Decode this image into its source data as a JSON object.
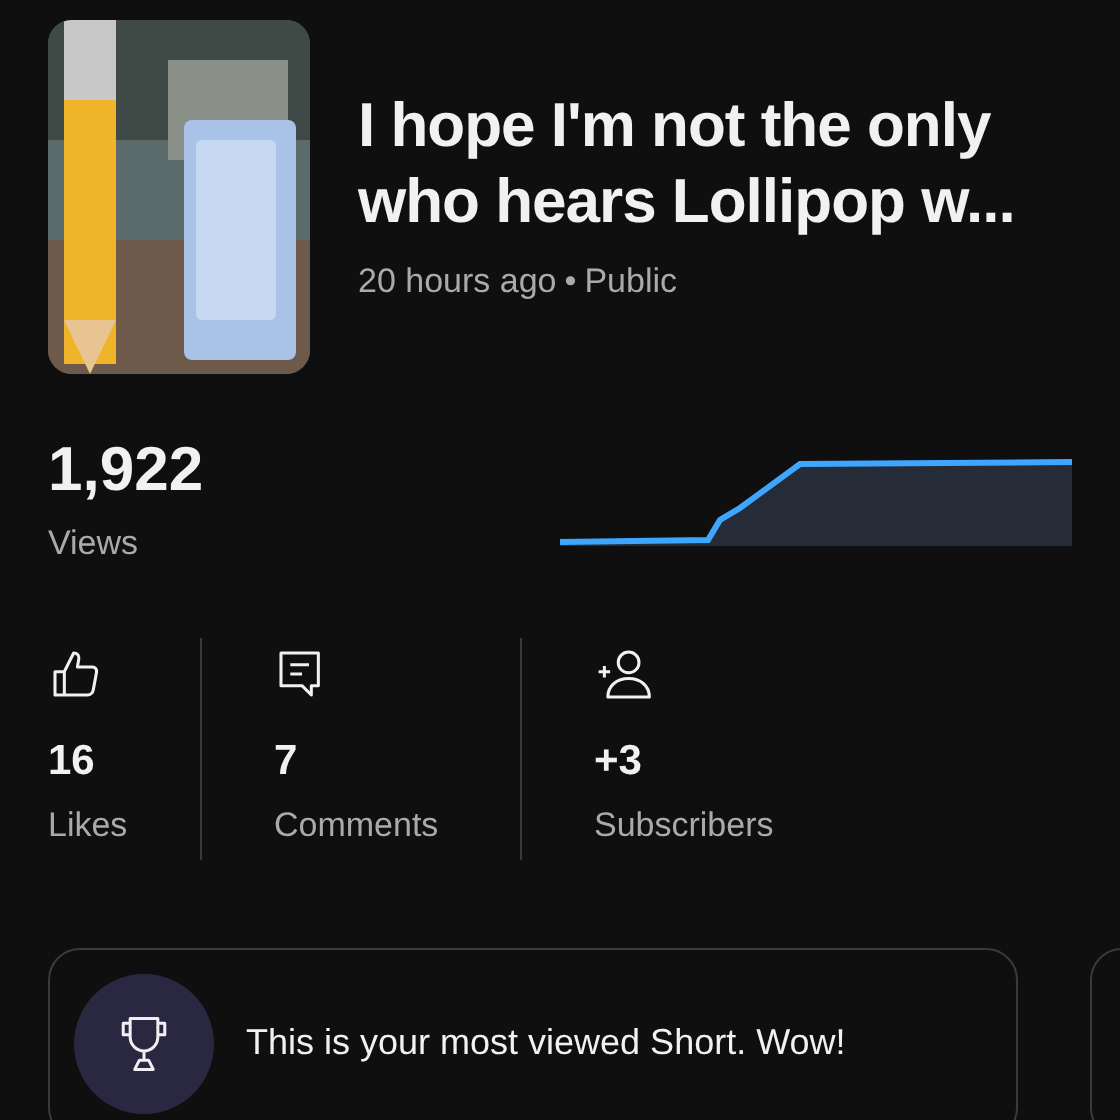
{
  "video": {
    "thumbnail": {
      "kind": "picture"
    },
    "title_lines": [
      "I hope I'm not the only",
      "who hears Lollipop w..."
    ],
    "age": "20 hours ago",
    "separator": "•",
    "visibility": "Public"
  },
  "views": {
    "value": "1,922",
    "label": "Views"
  },
  "stats": [
    {
      "kind": "likes",
      "value": "16",
      "label": "Likes"
    },
    {
      "kind": "comments",
      "value": "7",
      "label": "Comments"
    },
    {
      "kind": "subscribers",
      "value": "+3",
      "label": "Subscribers"
    }
  ],
  "insight": {
    "text": "This is your most viewed Short. Wow!"
  }
}
